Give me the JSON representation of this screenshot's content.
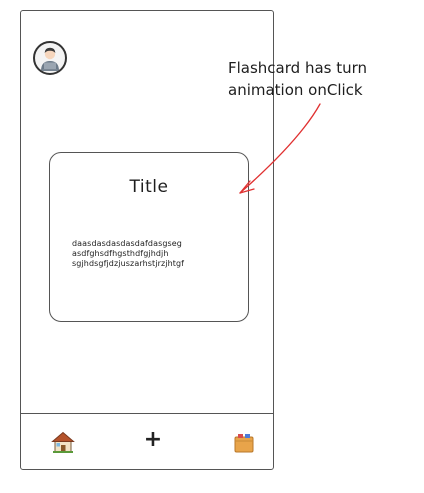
{
  "annotation": {
    "line1": "Flashcard has turn",
    "line2": "animation onClick"
  },
  "flashcard": {
    "title": "Title",
    "body_lines": [
      "daasdasdasdasdafdasgseg",
      "asdfghsdfhgsthdfgjhdjh",
      "sgjhdsgfjdzjuszarhstjrzjhtgf"
    ]
  },
  "nav": {
    "items": [
      {
        "icon": "house-icon"
      },
      {
        "icon": "plus-icon"
      },
      {
        "icon": "box-icon"
      }
    ]
  },
  "colors": {
    "annotation_arrow": "#e03131",
    "house_roof": "#b5532b",
    "box": "#e8a44a"
  }
}
